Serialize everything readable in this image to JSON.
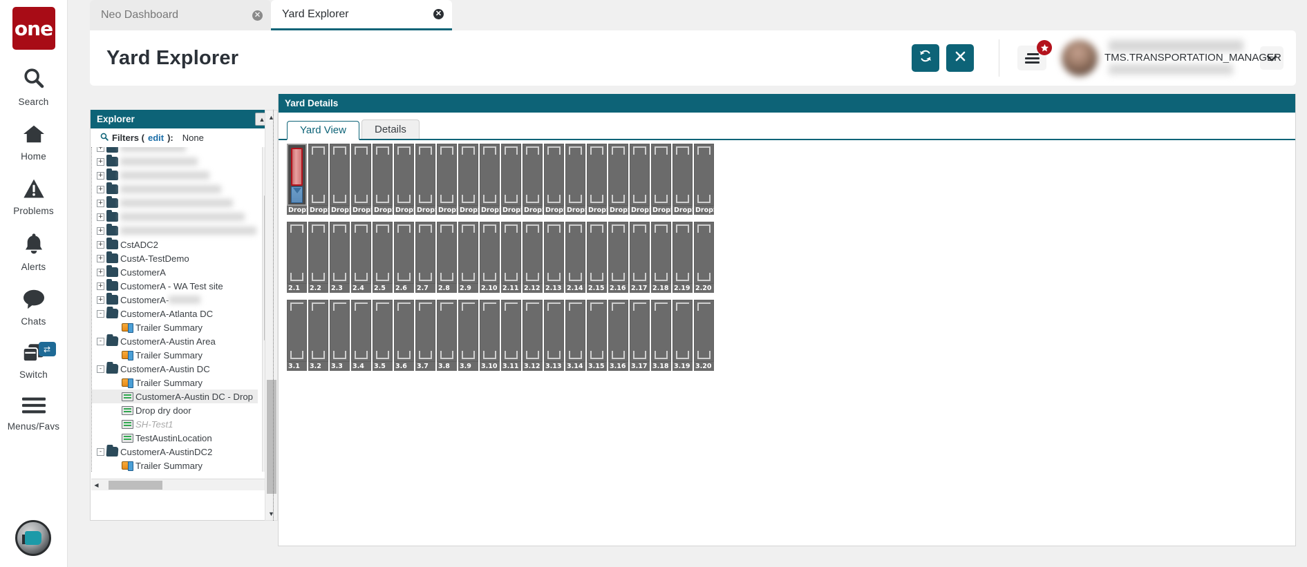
{
  "brand": {
    "logo_text": "one"
  },
  "rail": {
    "items": [
      {
        "icon": "search-icon",
        "label": "Search"
      },
      {
        "icon": "home-icon",
        "label": "Home"
      },
      {
        "icon": "problems-warning-icon",
        "label": "Problems"
      },
      {
        "icon": "bell-icon",
        "label": "Alerts"
      },
      {
        "icon": "chat-bubble-icon",
        "label": "Chats"
      },
      {
        "icon": "switch-windows-icon",
        "label": "Switch",
        "badge": "⇄"
      },
      {
        "icon": "hamburger-icon",
        "label": "Menus/Favs"
      }
    ],
    "assistant_icon": "ai-assistant-orb-icon"
  },
  "tabs": [
    {
      "label": "Neo Dashboard",
      "active": false,
      "close": "✕"
    },
    {
      "label": "Yard Explorer",
      "active": true,
      "close": "✕"
    }
  ],
  "header": {
    "title": "Yard Explorer",
    "refresh_icon": "refresh-icon",
    "close_icon": "close-icon",
    "menu_icon": "menu-icon",
    "star_badge_icon": "star-icon",
    "notification_badge_color": "#b3121c",
    "avatar_icon": "user-avatar",
    "user_role": "TMS.TRANSPORTATION_MANAGER",
    "chevron_icon": "chevron-down-icon"
  },
  "explorer": {
    "title": "Explorer",
    "collapse_icon": "collapse-up-icon",
    "filters": {
      "search_icon": "search-icon",
      "label": "Filters (",
      "edit_link": "edit",
      "label_end": "):",
      "value": "None"
    },
    "tree": [
      {
        "toggle": "+",
        "icon": "folder-icon",
        "label": "",
        "redacted": true,
        "depth": 0
      },
      {
        "toggle": "+",
        "icon": "folder-icon",
        "label": "",
        "redacted": true,
        "depth": 0
      },
      {
        "toggle": "+",
        "icon": "folder-icon",
        "label": "",
        "redacted": true,
        "depth": 0
      },
      {
        "toggle": "+",
        "icon": "folder-icon",
        "label": "",
        "redacted": true,
        "depth": 0
      },
      {
        "toggle": "+",
        "icon": "folder-icon",
        "label": "",
        "redacted": true,
        "depth": 0
      },
      {
        "toggle": "+",
        "icon": "folder-icon",
        "label": "",
        "redacted": true,
        "depth": 0
      },
      {
        "toggle": "+",
        "icon": "folder-icon",
        "label": "",
        "redacted": true,
        "depth": 0
      },
      {
        "toggle": "+",
        "icon": "folder-icon",
        "label": "CstADC2",
        "depth": 0
      },
      {
        "toggle": "+",
        "icon": "folder-icon",
        "label": "CustA-TestDemo",
        "depth": 0
      },
      {
        "toggle": "+",
        "icon": "folder-icon",
        "label": "CustomerA",
        "depth": 0
      },
      {
        "toggle": "+",
        "icon": "folder-icon",
        "label": "CustomerA - WA Test site",
        "depth": 0
      },
      {
        "toggle": "+",
        "icon": "folder-icon",
        "label": "CustomerA-",
        "redacted_suffix": true,
        "depth": 0
      },
      {
        "toggle": "-",
        "icon": "folder-open-icon",
        "label": "CustomerA-Atlanta DC",
        "depth": 0
      },
      {
        "toggle": "",
        "icon": "trailer-icon",
        "label": "Trailer Summary",
        "depth": 1
      },
      {
        "toggle": "-",
        "icon": "folder-open-icon",
        "label": "CustomerA-Austin Area",
        "depth": 0
      },
      {
        "toggle": "",
        "icon": "trailer-icon",
        "label": "Trailer Summary",
        "depth": 1
      },
      {
        "toggle": "-",
        "icon": "folder-open-icon",
        "label": "CustomerA-Austin DC",
        "depth": 0
      },
      {
        "toggle": "",
        "icon": "trailer-icon",
        "label": "Trailer Summary",
        "depth": 1
      },
      {
        "toggle": "",
        "icon": "dock-icon",
        "label": "CustomerA-Austin DC - Drop",
        "depth": 1,
        "selected": true
      },
      {
        "toggle": "",
        "icon": "dock-icon",
        "label": "Drop dry door",
        "depth": 1
      },
      {
        "toggle": "",
        "icon": "dock-icon",
        "label": "SH-Test1",
        "depth": 1,
        "ghost": true
      },
      {
        "toggle": "",
        "icon": "dock-icon",
        "label": "TestAustinLocation",
        "depth": 1
      },
      {
        "toggle": "-",
        "icon": "folder-open-icon",
        "label": "CustomerA-AustinDC2",
        "depth": 0
      },
      {
        "toggle": "",
        "icon": "trailer-icon",
        "label": "Trailer Summary",
        "depth": 1
      }
    ],
    "scroll_up_icon": "scroll-up-arrow-icon",
    "scroll_down_icon": "scroll-down-arrow-icon",
    "scroll_left_icon": "scroll-left-arrow-icon",
    "scroll_right_icon": "scroll-right-arrow-icon"
  },
  "yard": {
    "title": "Yard Details",
    "tabs": [
      {
        "label": "Yard View",
        "active": true
      },
      {
        "label": "Details",
        "active": false
      }
    ],
    "scroll_up_icon": "scroll-up-arrow-icon",
    "scroll_down_icon": "scroll-down-arrow-icon",
    "rows": [
      {
        "id": "row-1",
        "slots": [
          {
            "label": "DropS",
            "occupied": true,
            "trailer_color": "#cf7474",
            "tractor_color": "#5b8cbb"
          },
          {
            "label": "DropS"
          },
          {
            "label": "DropS"
          },
          {
            "label": "DropS"
          },
          {
            "label": "DropS"
          },
          {
            "label": "DropS"
          },
          {
            "label": "DropS"
          },
          {
            "label": "DropS"
          },
          {
            "label": "DropS"
          },
          {
            "label": "DropS"
          },
          {
            "label": "DropS"
          },
          {
            "label": "DropS"
          },
          {
            "label": "DropS"
          },
          {
            "label": "DropS"
          },
          {
            "label": "DropS"
          },
          {
            "label": "DropS"
          },
          {
            "label": "DropS"
          },
          {
            "label": "DropS"
          },
          {
            "label": "DropS"
          },
          {
            "label": "DropS"
          }
        ]
      },
      {
        "id": "row-2",
        "slots": [
          {
            "label": "2.1"
          },
          {
            "label": "2.2"
          },
          {
            "label": "2.3"
          },
          {
            "label": "2.4"
          },
          {
            "label": "2.5"
          },
          {
            "label": "2.6"
          },
          {
            "label": "2.7"
          },
          {
            "label": "2.8"
          },
          {
            "label": "2.9"
          },
          {
            "label": "2.10"
          },
          {
            "label": "2.11"
          },
          {
            "label": "2.12"
          },
          {
            "label": "2.13"
          },
          {
            "label": "2.14"
          },
          {
            "label": "2.15"
          },
          {
            "label": "2.16"
          },
          {
            "label": "2.17"
          },
          {
            "label": "2.18"
          },
          {
            "label": "2.19"
          },
          {
            "label": "2.20"
          }
        ]
      },
      {
        "id": "row-3",
        "slots": [
          {
            "label": "3.1"
          },
          {
            "label": "3.2"
          },
          {
            "label": "3.3"
          },
          {
            "label": "3.4"
          },
          {
            "label": "3.5"
          },
          {
            "label": "3.6"
          },
          {
            "label": "3.7"
          },
          {
            "label": "3.8"
          },
          {
            "label": "3.9"
          },
          {
            "label": "3.10"
          },
          {
            "label": "3.11"
          },
          {
            "label": "3.12"
          },
          {
            "label": "3.13"
          },
          {
            "label": "3.14"
          },
          {
            "label": "3.15"
          },
          {
            "label": "3.16"
          },
          {
            "label": "3.17"
          },
          {
            "label": "3.18"
          },
          {
            "label": "3.19"
          },
          {
            "label": "3.20"
          }
        ]
      }
    ]
  },
  "colors": {
    "teal": "#0d6377",
    "brand_red": "#a80c16",
    "link_blue": "#1b6ea8"
  }
}
